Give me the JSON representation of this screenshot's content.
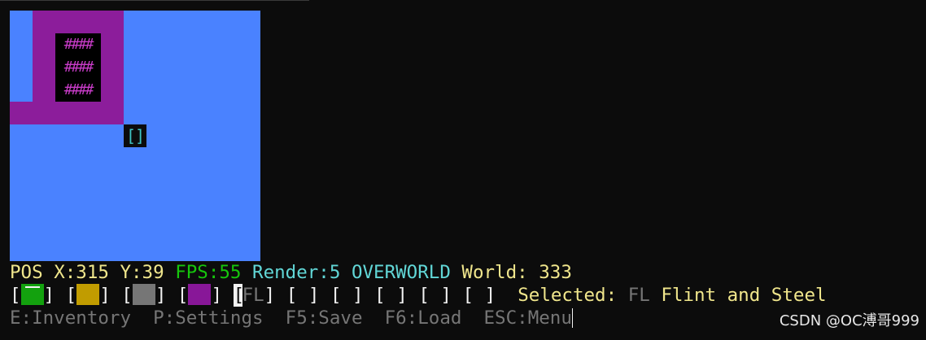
{
  "map": {
    "block_rows": [
      "####",
      "####",
      "####"
    ],
    "player_glyph": "[]",
    "colors": {
      "water": "#4a82ff",
      "wall": "#8c1d9b",
      "block": "#000000",
      "block_glyph": "#c83cc8",
      "player": "#3fc4c4"
    }
  },
  "status": {
    "pos_label": "POS",
    "x": "X:315",
    "y": "Y:39",
    "fps": "FPS:55",
    "render": "Render:5",
    "mode": "OVERWORLD",
    "world_label": "World:",
    "world_value": "333"
  },
  "hotbar": {
    "slots": [
      {
        "type": "color",
        "color": "#13a10e",
        "name": "green-swatch"
      },
      {
        "type": "color",
        "color": "#c19c00",
        "name": "gold-swatch"
      },
      {
        "type": "color",
        "color": "#767676",
        "name": "gray-swatch"
      },
      {
        "type": "color",
        "color": "#881798",
        "name": "purple-swatch"
      },
      {
        "type": "item",
        "code": "FL",
        "selected": true
      },
      {
        "type": "empty"
      },
      {
        "type": "empty"
      },
      {
        "type": "empty"
      },
      {
        "type": "empty"
      },
      {
        "type": "empty"
      }
    ],
    "selected_label": "Selected:",
    "selected_code": "FL",
    "selected_name": "Flint and Steel"
  },
  "controls": {
    "inventory": "E:Inventory",
    "settings": "P:Settings",
    "save": "F5:Save",
    "load": "F6:Load",
    "menu": "ESC:Menu"
  },
  "watermark": "CSDN @OC溥哥999"
}
